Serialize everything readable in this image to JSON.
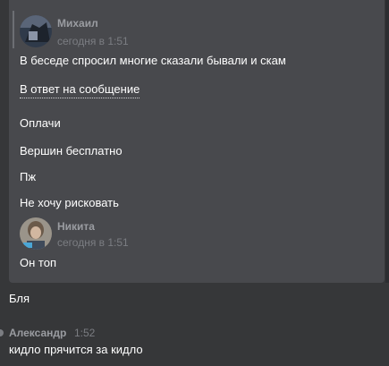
{
  "message1": {
    "author": "Михаил",
    "time": "сегодня в 1:51",
    "text": "В беседе спросил многие сказали бывали и скам",
    "reply_link": "В ответ на сообщение",
    "lines": [
      "Оплачи",
      "Вершин бесплатно",
      "Пж",
      "Не хочу рисковать"
    ]
  },
  "message2": {
    "author": "Никита",
    "time": "сегодня в 1:51",
    "text": "Он топ"
  },
  "message3": {
    "text": "Бля"
  },
  "message4": {
    "author": "Александр",
    "time": "1:52",
    "text": "кидло прячится за кидло"
  }
}
